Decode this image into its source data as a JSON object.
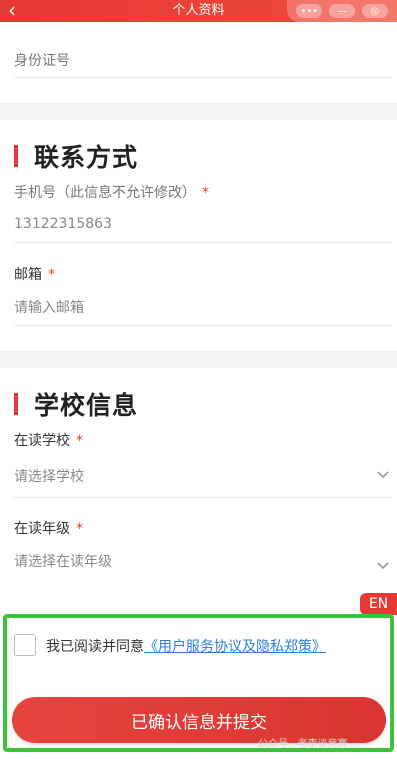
{
  "header": {
    "title": "个人资料",
    "back_icon": "‹",
    "capsule": [
      "•••",
      "—",
      "◎"
    ]
  },
  "id_section": {
    "label": "身份证号"
  },
  "contact": {
    "title": "联系方式",
    "phone_label": "手机号（此信息不允许修改）",
    "phone_required": "*",
    "phone_value": "13122315863",
    "email_label": "邮箱",
    "email_required": "*",
    "email_placeholder": "请输入邮箱"
  },
  "school": {
    "title": "学校信息",
    "school_label": "在读学校",
    "school_required": "*",
    "school_placeholder": "请选择学校",
    "grade_label": "在读年级",
    "grade_required": "*",
    "grade_placeholder": "请选择在读年级"
  },
  "lang_badge": "EN",
  "agreement": {
    "text": "我已阅读并同意",
    "link": "《用户服务协议及隐私郑策》"
  },
  "submit_label": "已确认信息并提交",
  "watermark": "公众号 · 老李谈竞赛",
  "colors": {
    "accent": "#e53935",
    "highlight_border": "#3bc43b",
    "link": "#2f7fd8"
  }
}
